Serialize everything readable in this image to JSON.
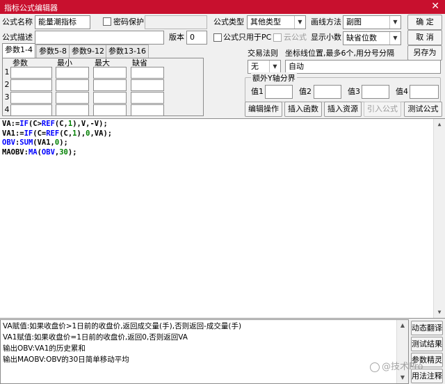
{
  "window": {
    "title": "指标公式编辑器",
    "close_glyph": "✕"
  },
  "form": {
    "name_label": "公式名称",
    "name_value": "能量潮指标",
    "password_label": "密码保护",
    "password_value": "",
    "type_label": "公式类型",
    "type_value": "其他类型",
    "draw_label": "画线方法",
    "draw_value": "副图",
    "desc_label": "公式描述",
    "desc_value": "",
    "version_label": "版本",
    "version_value": "0",
    "pc_only_label": "公式只用于PC",
    "cloud_label": "云公式",
    "decimal_label": "显示小数",
    "decimal_value": "缺省位数"
  },
  "buttons": {
    "ok": "确  定",
    "cancel": "取  消",
    "save_as": "另存为",
    "edit_ops": "编辑操作",
    "insert_func": "插入函数",
    "insert_res": "插入资源",
    "import_formula": "引入公式",
    "test_formula": "测试公式"
  },
  "tabs": [
    "参数1-4",
    "参数5-8",
    "参数9-12",
    "参数13-16"
  ],
  "param_table": {
    "headers": [
      "参数",
      "最小",
      "最大",
      "缺省"
    ],
    "rows": [
      "1",
      "2",
      "3",
      "4"
    ]
  },
  "trade": {
    "rule_label": "交易法则",
    "rule_value": "无",
    "coord_label": "坐标线位置,最多6个,用分号分隔",
    "coord_value": "自动",
    "yaxis_label": "额外Y轴分界",
    "val_labels": [
      "值1",
      "值2",
      "值3",
      "值4"
    ]
  },
  "code_lines": [
    "VA:=IF(C>REF(C,1),V,-V);",
    "VA1:=IF(C=REF(C,1),0,VA);",
    "OBV:SUM(VA1,0);",
    "MAOBV:MA(OBV,30);"
  ],
  "description_lines": [
    "VA赋值:如果收盘价>1日前的收盘价,返回成交量(手),否则返回-成交量(手)",
    "VA1赋值:如果收盘价=1日前的收盘价,返回0,否则返回VA",
    "输出OBV:VA1的历史累和",
    "输出MAOBV:OBV的30日简单移动平均"
  ],
  "side_buttons": [
    "动态翻译",
    "测试结果",
    "参数精灵",
    "用法注释"
  ],
  "watermark": "@技术Pro",
  "colors": {
    "title_bar": "#c8102e",
    "keyword": "#0000ff",
    "number": "#008000"
  }
}
